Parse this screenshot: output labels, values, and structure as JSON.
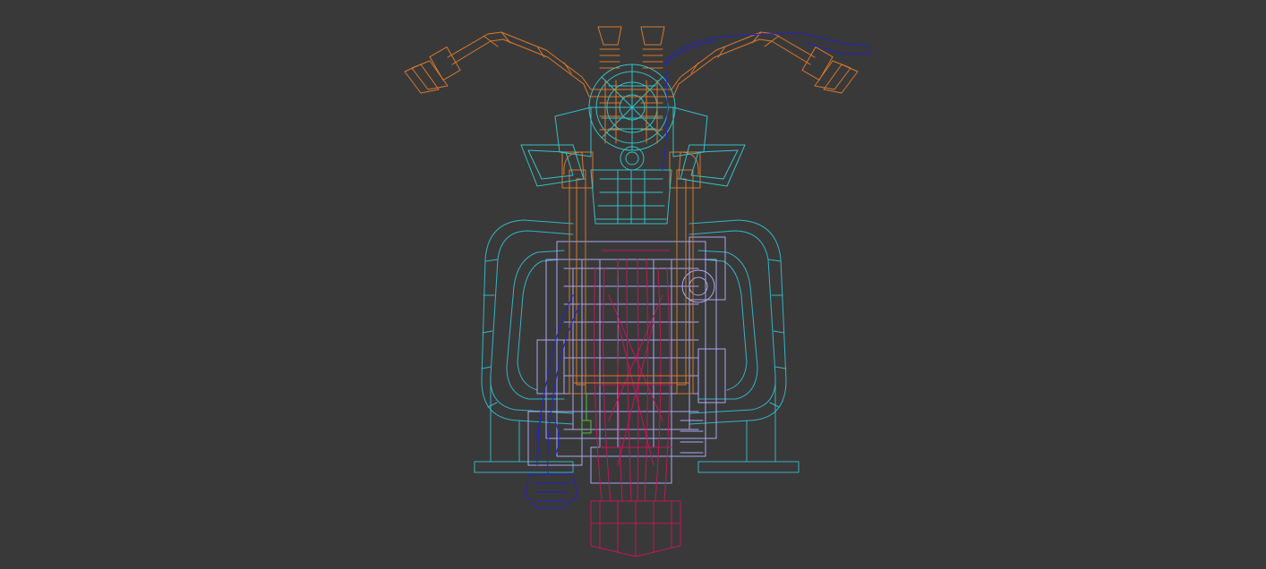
{
  "viewport": {
    "background": "#393939",
    "render_mode": "wireframe",
    "view": "front",
    "model": "motorcycle"
  },
  "wire_colors": {
    "handlebar": "#d8782c",
    "fairing": "#33c0c8",
    "crash_bar": "#33b4c4",
    "engine": "#a8a8f0",
    "fork": "#d8782c",
    "wheel": "#c0185a",
    "cable": "#2424c8",
    "accent": "#58c040"
  }
}
